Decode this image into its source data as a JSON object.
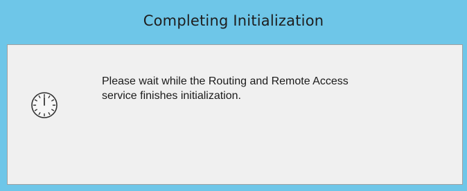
{
  "dialog": {
    "title": "Completing Initialization",
    "message_line1": "Please wait while the Routing and Remote Access",
    "message_line2": "service finishes initialization.",
    "icon": "clock-icon"
  },
  "colors": {
    "title_bar": "#6ec6e8",
    "content_background": "#f0f0f0",
    "content_border": "#a0a0a0"
  }
}
